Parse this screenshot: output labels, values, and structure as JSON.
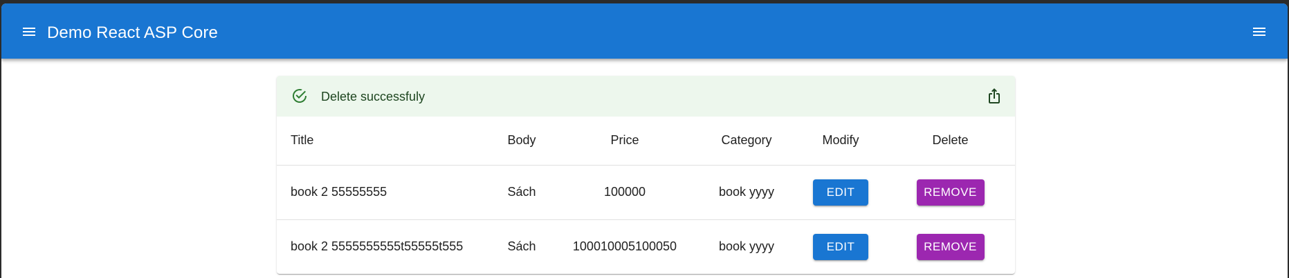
{
  "appbar": {
    "title": "Demo React ASP Core",
    "left_icon": "menu-icon",
    "right_icon": "menu-icon",
    "color": "#1976d2"
  },
  "alert": {
    "message": "Delete successfuly",
    "icon": "check-circle-outline-icon",
    "action_icon": "share-export-icon",
    "background": "#edf7ed"
  },
  "table": {
    "headers": {
      "title": "Title",
      "body": "Body",
      "price": "Price",
      "category": "Category",
      "modify": "Modify",
      "delete": "Delete"
    },
    "rows": [
      {
        "title": "book 2 55555555",
        "body": "Sách",
        "price": "100000",
        "category": "book yyyy",
        "edit_label": "EDIT",
        "remove_label": "REMOVE"
      },
      {
        "title": "book 2 5555555555t55555t555",
        "body": "Sách",
        "price": "100010005100050",
        "category": "book yyyy",
        "edit_label": "EDIT",
        "remove_label": "REMOVE"
      }
    ]
  },
  "colors": {
    "edit_button": "#1976d2",
    "remove_button": "#9c27b0"
  }
}
